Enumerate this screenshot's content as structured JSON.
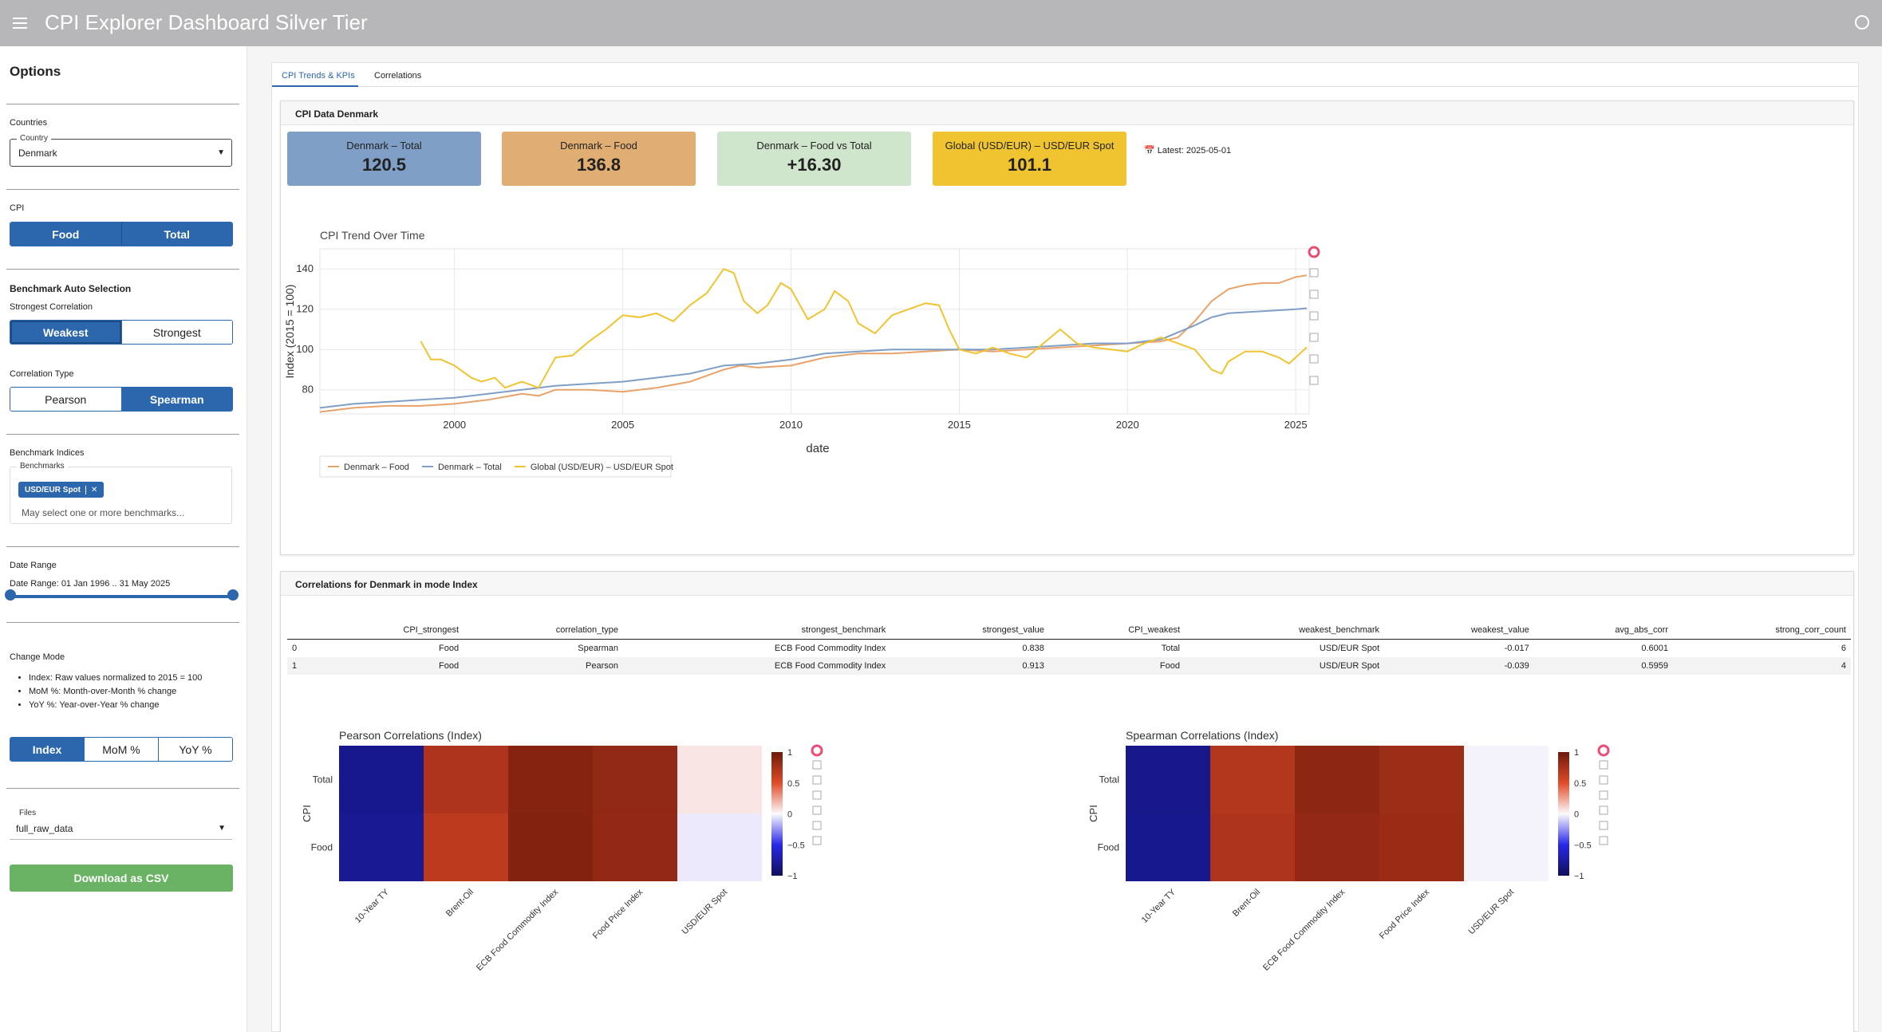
{
  "header": {
    "title": "CPI Explorer Dashboard Silver Tier"
  },
  "sidebar": {
    "title": "Options",
    "countries_label": "Countries",
    "country_field_label": "Country",
    "country_value": "Denmark",
    "cpi_label": "CPI",
    "cpi_buttons": [
      "Food",
      "Total"
    ],
    "benchmark_auto_label": "Benchmark Auto Selection",
    "strongest_corr_label": "Strongest Correlation",
    "strength_buttons": [
      "Weakest",
      "Strongest"
    ],
    "corr_type_label": "Correlation Type",
    "corr_type_buttons": [
      "Pearson",
      "Spearman"
    ],
    "benchmark_indices_label": "Benchmark Indices",
    "benchmarks_field_label": "Benchmarks",
    "benchmark_chip": "USD/EUR Spot",
    "benchmark_placeholder": "May select one or more benchmarks...",
    "date_range_label": "Date Range",
    "date_range_value": "Date Range: 01 Jan 1996 .. 31 May 2025",
    "change_mode_label": "Change Mode",
    "change_mode_notes": [
      "Index: Raw values normalized to 2015 = 100",
      "MoM %: Month-over-Month % change",
      "YoY %: Year-over-Year % change"
    ],
    "mode_buttons": [
      "Index",
      "MoM %",
      "YoY %"
    ],
    "files_label": "Files",
    "files_value": "full_raw_data",
    "download_button": "Download as CSV"
  },
  "tabs": [
    "CPI Trends & KPIs",
    "Correlations"
  ],
  "cpi_card": {
    "title": "CPI Data Denmark",
    "kpis": [
      {
        "label": "Denmark – Total",
        "value": "120.5",
        "color": "#7f9fc6"
      },
      {
        "label": "Denmark – Food",
        "value": "136.8",
        "color": "#e0ad73"
      },
      {
        "label": "Denmark – Food vs Total",
        "value": "+16.30",
        "color": "#cfe5cc"
      },
      {
        "label": "Global (USD/EUR) – USD/EUR Spot",
        "value": "101.1",
        "color": "#f0c431"
      }
    ],
    "latest_icon": "calendar-icon",
    "latest": "Latest: 2025-05-01"
  },
  "chart_data": {
    "type": "line",
    "title": "CPI Trend Over Time",
    "xlabel": "date",
    "ylabel": "Index (2015 = 100)",
    "xlim": [
      1996.0,
      2025.4
    ],
    "ylim": [
      68,
      150
    ],
    "x_ticks": [
      2000,
      2005,
      2010,
      2015,
      2020,
      2025
    ],
    "y_ticks": [
      80,
      100,
      120,
      140
    ],
    "grid": true,
    "legend_position": "bottom-left",
    "series": [
      {
        "name": "Denmark – Food",
        "color": "#e8a36a",
        "x": [
          1996.0,
          1997.0,
          1998.0,
          1999.0,
          2000.0,
          2001.0,
          2002.0,
          2002.5,
          2003.0,
          2004.0,
          2005.0,
          2006.0,
          2007.0,
          2008.0,
          2008.5,
          2009.0,
          2010.0,
          2011.0,
          2012.0,
          2013.0,
          2014.0,
          2015.0,
          2016.0,
          2017.0,
          2018.0,
          2019.0,
          2020.0,
          2021.0,
          2021.5,
          2022.0,
          2022.5,
          2023.0,
          2023.5,
          2024.0,
          2024.5,
          2025.0,
          2025.33
        ],
        "y": [
          69,
          71,
          72,
          72,
          73,
          75,
          78,
          77,
          80,
          80,
          79,
          81,
          84,
          90,
          92,
          91,
          92,
          96,
          98,
          98,
          99,
          100,
          99,
          100,
          101,
          102,
          103,
          104,
          106,
          114,
          124,
          130,
          132,
          133,
          133,
          136,
          136.8
        ]
      },
      {
        "name": "Denmark – Total",
        "color": "#7f9fc6",
        "x": [
          1996.0,
          1997.0,
          1998.0,
          1999.0,
          2000.0,
          2001.0,
          2002.0,
          2003.0,
          2004.0,
          2005.0,
          2006.0,
          2007.0,
          2008.0,
          2009.0,
          2010.0,
          2011.0,
          2012.0,
          2013.0,
          2014.0,
          2015.0,
          2016.0,
          2017.0,
          2018.0,
          2019.0,
          2020.0,
          2021.0,
          2022.0,
          2022.5,
          2023.0,
          2024.0,
          2025.0,
          2025.33
        ],
        "y": [
          71,
          73,
          74,
          75,
          76,
          78,
          80,
          82,
          83,
          84,
          86,
          88,
          92,
          93,
          95,
          98,
          99,
          100,
          100,
          100,
          100,
          101,
          102,
          103,
          103,
          105,
          112,
          116,
          118,
          119,
          120,
          120.5
        ]
      },
      {
        "name": "Global (USD/EUR) – USD/EUR Spot",
        "color": "#f0c431",
        "x": [
          1999.0,
          1999.3,
          1999.6,
          2000.0,
          2000.5,
          2000.8,
          2001.2,
          2001.5,
          2002.0,
          2002.5,
          2003.0,
          2003.5,
          2004.0,
          2004.5,
          2005.0,
          2005.5,
          2006.0,
          2006.5,
          2007.0,
          2007.5,
          2008.0,
          2008.3,
          2008.6,
          2009.0,
          2009.3,
          2009.7,
          2010.0,
          2010.5,
          2011.0,
          2011.3,
          2011.7,
          2012.0,
          2012.5,
          2013.0,
          2013.5,
          2014.0,
          2014.4,
          2014.7,
          2015.0,
          2015.5,
          2016.0,
          2016.5,
          2017.0,
          2017.5,
          2018.0,
          2018.5,
          2019.0,
          2019.5,
          2020.0,
          2020.5,
          2021.0,
          2021.5,
          2022.0,
          2022.5,
          2022.8,
          2023.0,
          2023.5,
          2024.0,
          2024.5,
          2024.8,
          2025.0,
          2025.33
        ],
        "y": [
          104,
          95,
          95,
          92,
          86,
          84,
          86,
          81,
          84,
          81,
          96,
          97,
          104,
          110,
          117,
          116,
          118,
          114,
          122,
          128,
          140,
          138,
          124,
          118,
          122,
          133,
          130,
          115,
          120,
          129,
          124,
          113,
          108,
          117,
          120,
          123,
          122,
          110,
          100,
          98,
          101,
          98,
          96,
          103,
          110,
          103,
          101,
          100,
          99,
          103,
          106,
          103,
          100,
          90,
          88,
          94,
          99,
          99,
          96,
          93,
          96,
          101.1
        ]
      }
    ]
  },
  "corr_card": {
    "title": "Correlations for Denmark in mode Index",
    "columns": [
      "",
      "CPI_strongest",
      "correlation_type",
      "strongest_benchmark",
      "strongest_value",
      "CPI_weakest",
      "weakest_benchmark",
      "weakest_value",
      "avg_abs_corr",
      "strong_corr_count"
    ],
    "rows": [
      [
        "0",
        "Food",
        "Spearman",
        "ECB Food Commodity Index",
        "0.838",
        "Total",
        "USD/EUR Spot",
        "-0.017",
        "0.6001",
        "6"
      ],
      [
        "1",
        "Food",
        "Pearson",
        "ECB Food Commodity Index",
        "0.913",
        "Food",
        "USD/EUR Spot",
        "-0.039",
        "0.5959",
        "4"
      ]
    ],
    "heatmaps": [
      {
        "title": "Pearson Correlations (Index)",
        "ylabel": "CPI",
        "rows": [
          "Total",
          "Food"
        ],
        "cols": [
          "10-Year TY",
          "Brent-Oil",
          "ECB Food Commodity Index",
          "Food Price Index",
          "USD/EUR Spot"
        ],
        "values": [
          [
            -0.82,
            0.72,
            0.9,
            0.85,
            0.06
          ],
          [
            -0.8,
            0.66,
            0.91,
            0.84,
            -0.04
          ]
        ],
        "colorbar_ticks": [
          "1",
          "0.5",
          "0",
          "−0.5",
          "−1"
        ]
      },
      {
        "title": "Spearman Correlations (Index)",
        "ylabel": "CPI",
        "rows": [
          "Total",
          "Food"
        ],
        "cols": [
          "10-Year TY",
          "Brent-Oil",
          "ECB Food Commodity Index",
          "Food Price Index",
          "USD/EUR Spot"
        ],
        "values": [
          [
            -0.83,
            0.7,
            0.86,
            0.8,
            -0.02
          ],
          [
            -0.82,
            0.72,
            0.84,
            0.81,
            -0.02
          ]
        ],
        "colorbar_ticks": [
          "1",
          "0.5",
          "0",
          "−0.5",
          "−1"
        ]
      }
    ]
  }
}
